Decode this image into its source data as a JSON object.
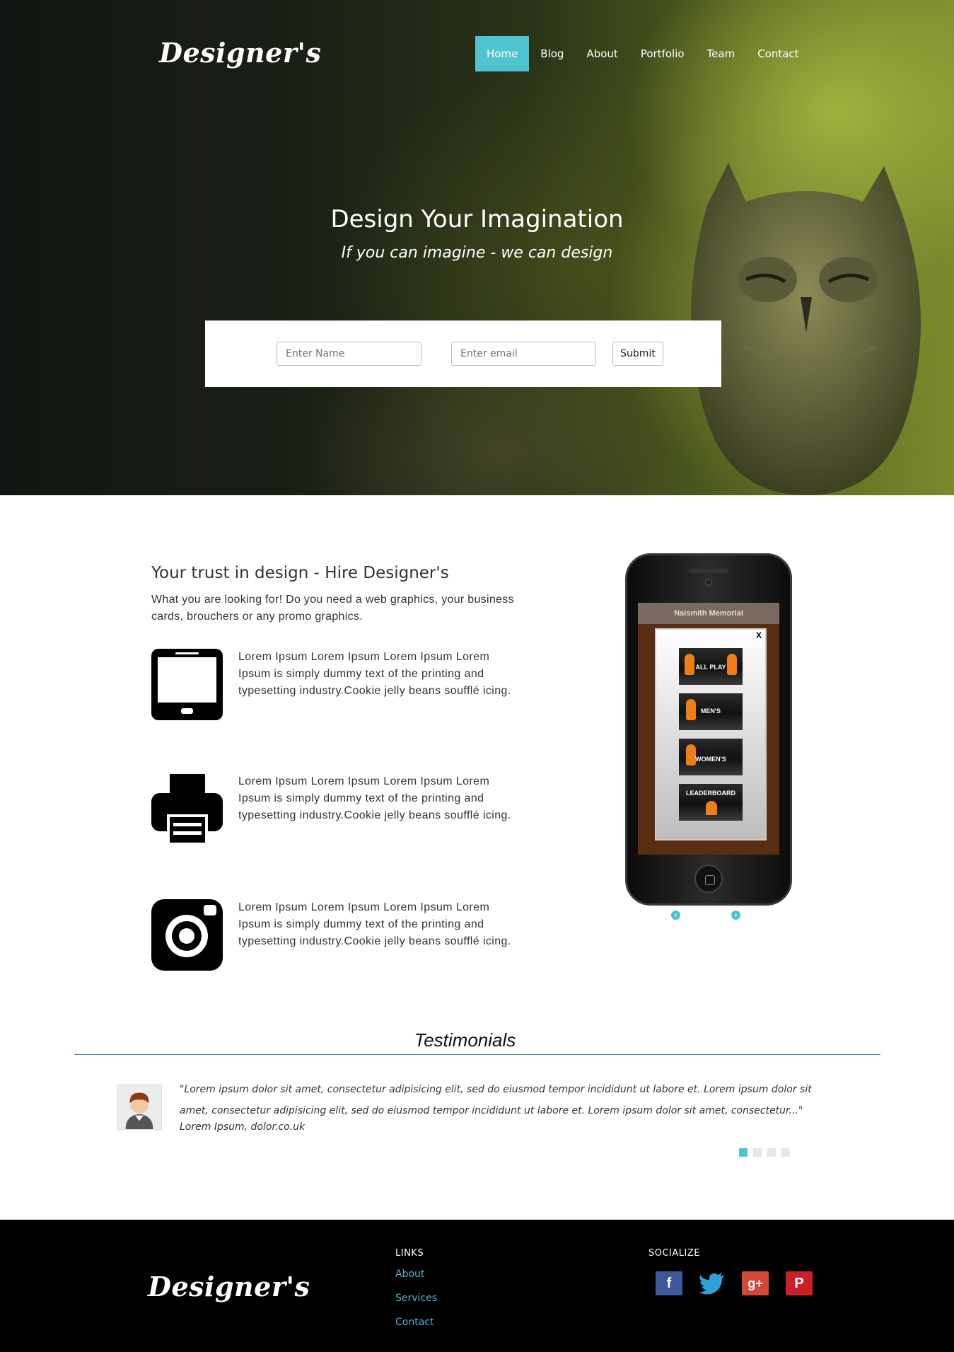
{
  "brand": {
    "logo_text": "Designer's"
  },
  "nav": {
    "items": [
      "Home",
      "Blog",
      "About",
      "Portfolio",
      "Team",
      "Contact"
    ],
    "active": "Home",
    "accent": "#4fc4cf"
  },
  "hero": {
    "title": "Design Your Imagination",
    "subtitle": "If you can imagine - we can design",
    "form": {
      "name_placeholder": "Enter Name",
      "email_placeholder": "Enter email",
      "submit_label": "Submit"
    }
  },
  "features": {
    "title": "Your trust in design - Hire Designer's",
    "intro": "What you are looking for! Do you need a web graphics, your business cards, brouchers or any promo graphics.",
    "items": [
      {
        "icon": "tablet-icon",
        "text": "Lorem Ipsum Lorem Ipsum Lorem Ipsum Lorem Ipsum is simply dummy text of the printing and typesetting industry.Cookie jelly beans soufflé icing."
      },
      {
        "icon": "printer-icon",
        "text": "Lorem Ipsum Lorem Ipsum Lorem Ipsum Lorem Ipsum is simply dummy text of the printing and typesetting industry.Cookie jelly beans soufflé icing."
      },
      {
        "icon": "camera-icon",
        "text": "Lorem Ipsum Lorem Ipsum Lorem Ipsum Lorem Ipsum is simply dummy text of the printing and typesetting industry.Cookie jelly beans soufflé icing."
      }
    ]
  },
  "phone": {
    "screen_title": "Naismith Memorial",
    "close_label": "X",
    "menu": [
      "ALL PLAY",
      "MEN'S",
      "WOMEN'S",
      "LEADERBOARD"
    ]
  },
  "testimonials": {
    "title": "Testimonials",
    "quote": "\"Lorem ipsum dolor sit amet, consectetur adipisicing elit, sed do eiusmod tempor incididunt ut labore et. Lorem ipsum dolor sit amet, consectetur adipisicing elit, sed do eiusmod tempor incididunt ut labore et. Lorem ipsum dolor sit amet, consectetur...\"",
    "author": "Lorem Ipsum, dolor.co.uk",
    "pages": 4,
    "active_page": 1
  },
  "footer": {
    "links_heading": "LINKS",
    "links": [
      "About",
      "Services",
      "Contact"
    ],
    "social_heading": "SOCIALIZE",
    "social": [
      {
        "icon": "facebook-icon",
        "glyph": "f",
        "color": "#3b5998"
      },
      {
        "icon": "twitter-icon",
        "glyph": "t",
        "color": "#2aa3d8"
      },
      {
        "icon": "google-plus-icon",
        "glyph": "g+",
        "color": "#d34836"
      },
      {
        "icon": "pinterest-icon",
        "glyph": "P",
        "color": "#cb2027"
      }
    ]
  }
}
